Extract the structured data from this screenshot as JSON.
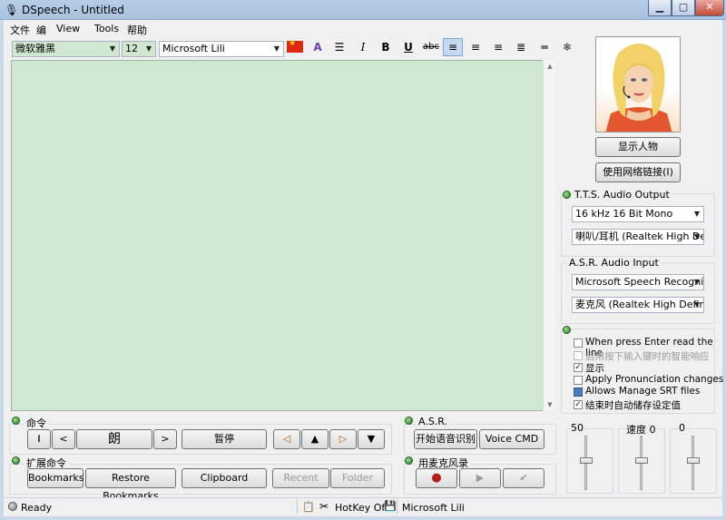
{
  "window": {
    "title": "DSpeech - Untitled"
  },
  "menu": [
    "文件",
    "编",
    "View",
    "Tools",
    "帮助"
  ],
  "toolbar": {
    "font_name": "微软雅黑",
    "font_size": "12",
    "voice": "Microsoft Lili"
  },
  "right_panel": {
    "show_character_label": "显示人物",
    "use_network_label": "使用网络链接(I)",
    "tts_output": {
      "title": "T.T.S. Audio Output",
      "format": "16 kHz 16 Bit Mono",
      "device": "喇叭/耳机 (Realtek High Defi"
    },
    "asr_input": {
      "title": "A.S.R. Audio Input",
      "engine": "Microsoft Speech Recognize",
      "device": "麦克风 (Realtek High Definiti"
    },
    "options": [
      {
        "label": "When press Enter read the line",
        "checked": false,
        "enabled": true
      },
      {
        "label": "启用按下输入键时的智能响应",
        "checked": false,
        "enabled": false
      },
      {
        "label": "显示",
        "checked": true,
        "enabled": true
      },
      {
        "label": "Apply Pronunciation changes",
        "checked": false,
        "enabled": true
      },
      {
        "label": "Allows Manage SRT files",
        "checked": false,
        "enabled": true
      },
      {
        "label": "结束时自动储存设定值",
        "checked": true,
        "enabled": true
      }
    ],
    "sliders": [
      {
        "label": "50",
        "value": 50
      },
      {
        "label": "速度 0",
        "value": 0
      },
      {
        "label": "0",
        "value": 0
      }
    ]
  },
  "command_group": {
    "title": "命令",
    "read_label": "朗",
    "pause_label": "暂停"
  },
  "asr_group": {
    "title": "A.S.R.",
    "start_label": "开始语音识别",
    "voice_cmd_label": "Voice CMD"
  },
  "ext_group": {
    "title": "扩展命令",
    "bookmarks_label": "Bookmarks",
    "restore_bookmarks_label": "Restore Bookmarks",
    "clipboard_label": "Clipboard",
    "recent_label": "Recent",
    "folder_label": "Folder"
  },
  "mic_group": {
    "title": "用麦克风录"
  },
  "status": {
    "state": "Ready",
    "hotkey": "HotKey Off",
    "voice": "Microsoft Lili"
  },
  "colors": {
    "editor_bg": "#cfe8d4",
    "accent": "#c5daf0"
  }
}
